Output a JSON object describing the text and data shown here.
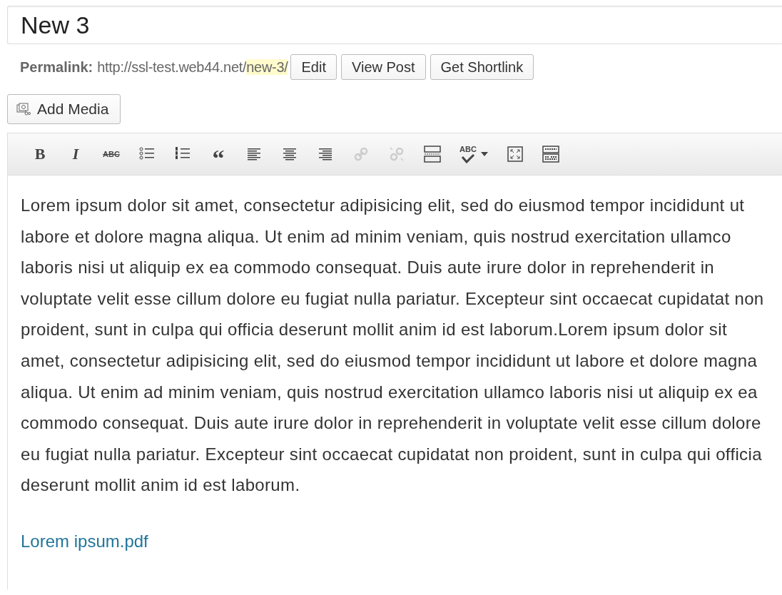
{
  "title_field": {
    "value": "New 3"
  },
  "permalink": {
    "label": "Permalink:",
    "url_base": "http://ssl-test.web44.net/",
    "slug": "new-3/",
    "buttons": [
      "Edit",
      "View Post",
      "Get Shortlink"
    ]
  },
  "add_media": {
    "label": "Add Media"
  },
  "toolbar": [
    {
      "kind": "bold",
      "label": "B",
      "disabled": false
    },
    {
      "kind": "italic",
      "label": "I",
      "disabled": false
    },
    {
      "kind": "strikethrough",
      "label": "ABC",
      "disabled": false
    },
    {
      "kind": "bullets",
      "disabled": false
    },
    {
      "kind": "numbers",
      "disabled": false
    },
    {
      "kind": "quote",
      "label": "“",
      "disabled": false
    },
    {
      "kind": "alignleft",
      "disabled": false
    },
    {
      "kind": "aligncenter",
      "disabled": false
    },
    {
      "kind": "alignright",
      "disabled": false
    },
    {
      "kind": "link",
      "disabled": true
    },
    {
      "kind": "unlink",
      "disabled": true
    },
    {
      "kind": "more",
      "disabled": false
    },
    {
      "kind": "spellcheck",
      "label": "ABC",
      "disabled": false
    },
    {
      "kind": "fullscreen",
      "disabled": false
    },
    {
      "kind": "kitchensink",
      "disabled": false
    }
  ],
  "content": {
    "paragraph": "Lorem ipsum dolor sit amet, consectetur adipisicing elit, sed do eiusmod tempor incididunt ut labore et dolore magna aliqua. Ut enim ad minim veniam, quis nostrud exercitation ullamco laboris nisi ut aliquip ex ea commodo consequat. Duis aute irure dolor in reprehenderit in voluptate velit esse cillum dolore eu fugiat nulla pariatur. Excepteur sint occaecat cupidatat non proident, sunt in culpa qui officia deserunt mollit anim id est laborum.Lorem ipsum dolor sit amet, consectetur adipisicing elit, sed do eiusmod tempor incididunt ut labore et dolore magna aliqua. Ut enim ad minim veniam, quis nostrud exercitation ullamco laboris nisi ut aliquip ex ea commodo consequat. Duis aute irure dolor in reprehenderit in voluptate velit esse cillum dolore eu fugiat nulla pariatur. Excepteur sint occaecat cupidatat non proident, sunt in culpa qui officia deserunt mollit anim id est laborum.",
    "link": "Lorem ipsum.pdf"
  }
}
